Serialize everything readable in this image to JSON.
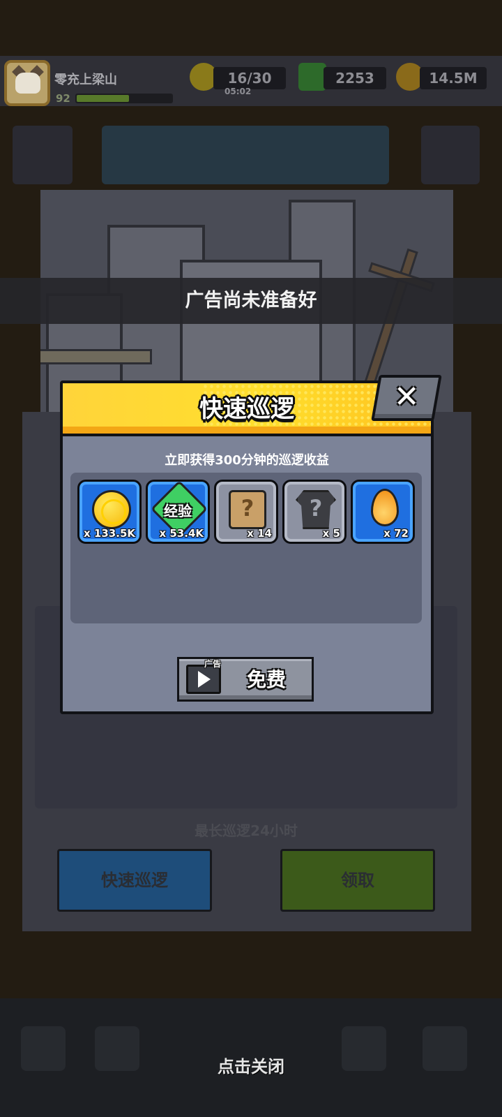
{
  "player": {
    "name": "零充上梁山",
    "level": "92",
    "xp_progress": 0.55
  },
  "resources": {
    "energy": "16/30",
    "energy_timer": "05:02",
    "gems": "2253",
    "gold": "14.5M"
  },
  "background": {
    "patrol_limit": "最长巡逻24小时",
    "quick_patrol_button": "快速巡逻",
    "claim_button": "领取"
  },
  "toast": {
    "message": "广告尚未准备好"
  },
  "modal": {
    "title": "快速巡逻",
    "close_symbol": "✕",
    "subtitle": "立即获得300分钟的巡逻收益",
    "rewards": [
      {
        "icon": "gold-coin-icon",
        "count": "x 133.5K"
      },
      {
        "icon": "exp-gem-icon",
        "label": "经验",
        "count": "x 53.4K"
      },
      {
        "icon": "mystery-scroll-icon",
        "count": "x 14"
      },
      {
        "icon": "mystery-shirt-icon",
        "count": "x 5"
      },
      {
        "icon": "fire-drop-icon",
        "count": "x 72"
      }
    ],
    "ad_tag": "广告",
    "free_button": "免费"
  },
  "tap_to_close": "点击关闭",
  "colors": {
    "header_yellow": "#ffd43a",
    "modal_body": "#7c8398",
    "reward_area": "#5e6478",
    "rare_blue": "#1f6fe0",
    "common_gray": "#8d92a2"
  }
}
